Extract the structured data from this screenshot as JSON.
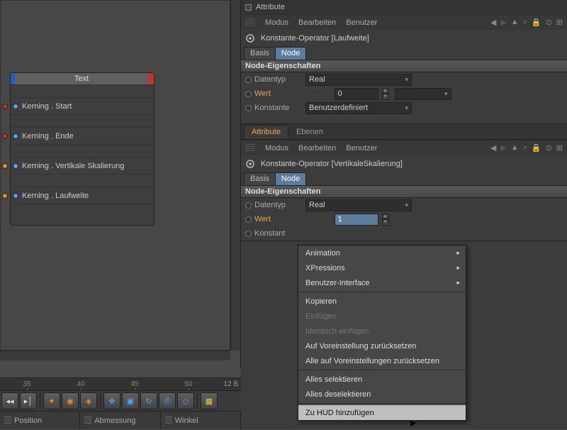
{
  "viewport": {
    "node_title": "Text",
    "rows": [
      "Kerning . Start",
      "Kerning . Ende",
      "Kerning . Vertikale Skalierung",
      "Kerning . Laufweite"
    ]
  },
  "timeline": {
    "ticks": [
      "35",
      "40",
      "45",
      "50"
    ],
    "label": "12 B"
  },
  "statusbar": {
    "cells": [
      "Position",
      "Abmessung",
      "Winkel"
    ]
  },
  "panel1": {
    "title": "Attribute",
    "menu": [
      "Modus",
      "Bearbeiten",
      "Benutzer"
    ],
    "object": "Konstante-Operator [Laufweite]",
    "tabs": [
      "Basis",
      "Node"
    ],
    "section": "Node-Eigenschaften",
    "props": {
      "datentyp_label": "Datentyp",
      "datentyp_value": "Real",
      "wert_label": "Wert",
      "wert_value": "0",
      "konstante_label": "Konstante",
      "konstante_value": "Benutzerdefiniert"
    }
  },
  "panel2": {
    "tabs": [
      "Attribute",
      "Ebenen"
    ],
    "menu": [
      "Modus",
      "Bearbeiten",
      "Benutzer"
    ],
    "object": "Konstante-Operator [VertikaleSkalierung]",
    "sub_tabs": [
      "Basis",
      "Node"
    ],
    "section": "Node-Eigenschaften",
    "props": {
      "datentyp_label": "Datentyp",
      "datentyp_value": "Real",
      "wert_label": "Wert",
      "wert_value": "1",
      "konstante_label": "Konstant"
    }
  },
  "context_menu": {
    "items": [
      {
        "label": "Animation",
        "arrow": true
      },
      {
        "label": "XPressions",
        "arrow": true
      },
      {
        "label": "Benutzer-Interface",
        "arrow": true
      },
      {
        "sep": true
      },
      {
        "label": "Kopieren"
      },
      {
        "label": "Einfügen",
        "disabled": true
      },
      {
        "label": "Identisch einfügen",
        "disabled": true
      },
      {
        "label": "Auf Voreinstellung zurücksetzen"
      },
      {
        "label": "Alle auf Voreinstellungen zurücksetzen"
      },
      {
        "sep": true
      },
      {
        "label": "Alles selektieren"
      },
      {
        "label": "Alles deselektieren"
      },
      {
        "sep": true
      },
      {
        "label": "Zu HUD hinzufügen",
        "hover": true
      }
    ]
  }
}
